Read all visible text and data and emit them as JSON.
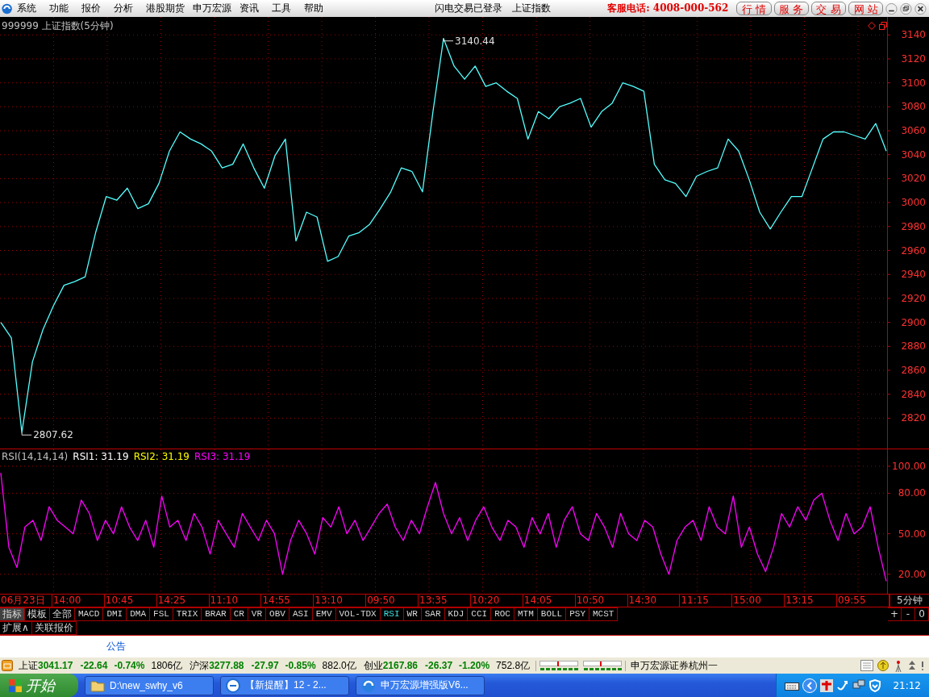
{
  "menu_bar": {
    "items": [
      "系统",
      "功能",
      "报价",
      "分析",
      "港股期货",
      "申万宏源",
      "资讯",
      "工具",
      "帮助"
    ],
    "login_status": "闪电交易已登录",
    "symbol": "上证指数",
    "hotline": "客服电话: 4008-000-562",
    "service_buttons": [
      "行 情",
      "服 务",
      "交 易",
      "网 站"
    ]
  },
  "price_panel": {
    "title": "999999 上证指数(5分钟)",
    "chart_data": {
      "type": "line",
      "ylim": [
        2794,
        3155
      ],
      "grid": true,
      "yticks": [
        2820,
        2840,
        2860,
        2880,
        2900,
        2920,
        2940,
        2960,
        2980,
        3000,
        3020,
        3040,
        3060,
        3080,
        3100,
        3120,
        3140
      ],
      "categories": [
        null,
        null,
        null,
        null,
        null,
        null,
        null,
        null,
        null,
        null,
        null,
        null,
        null,
        null,
        null,
        null,
        null,
        null,
        null,
        null,
        null,
        null,
        null,
        null,
        null,
        null,
        null,
        null,
        null,
        null,
        null,
        null,
        null,
        null,
        null,
        null,
        null,
        null,
        null,
        null,
        null,
        null,
        null,
        null,
        null,
        null,
        null,
        null,
        null,
        null,
        null,
        null,
        null,
        null,
        null,
        null,
        null,
        null,
        null,
        null,
        null,
        null,
        null,
        null,
        null,
        null,
        null,
        null,
        null,
        null,
        null,
        null,
        null,
        null,
        null,
        null,
        null,
        null,
        null,
        null,
        null,
        null,
        null,
        null,
        null
      ],
      "series": [
        {
          "color": "#54ffff",
          "values": [
            2900,
            2887,
            2808,
            2867,
            2894,
            2914,
            2931,
            2934,
            2938,
            2975,
            3005,
            3002,
            3012,
            2995,
            2999,
            3016,
            3043,
            3059,
            3053,
            3049,
            3043,
            3029,
            3032,
            3049,
            3029,
            3012,
            3039,
            3053,
            2968,
            2992,
            2988,
            2951,
            2955,
            2972,
            2975,
            2982,
            2995,
            3009,
            3029,
            3026,
            3009,
            3076,
            3137,
            3114,
            3103,
            3114,
            3097,
            3100,
            3093,
            3087,
            3053,
            3076,
            3070,
            3080,
            3083,
            3087,
            3063,
            3076,
            3083,
            3100,
            3097,
            3093,
            3032,
            3019,
            3016,
            3005,
            3022,
            3026,
            3029,
            3053,
            3043,
            3019,
            2992,
            2978,
            2992,
            3005,
            3005,
            3029,
            3053,
            3059,
            3059,
            3056,
            3053,
            3066,
            3043
          ]
        }
      ]
    },
    "extreme_labels": [
      {
        "kind": "max",
        "text": "3140.44"
      },
      {
        "kind": "min",
        "text": "2807.62"
      }
    ]
  },
  "rsi_panel": {
    "legend": [
      {
        "text": "RSI(14,14,14)",
        "color": "#c0c0c0"
      },
      {
        "text": "RSI1: 31.19",
        "color": "#ffffff"
      },
      {
        "text": "RSI2: 31.19",
        "color": "#ffff00"
      },
      {
        "text": "RSI3: 31.19",
        "color": "#ff00ff"
      }
    ],
    "chart_data": {
      "type": "line",
      "ylim": [
        5,
        112.5
      ],
      "grid": true,
      "yticks": [
        {
          "value": 20,
          "label": "20.00"
        },
        {
          "value": 50,
          "label": "50.00"
        },
        {
          "value": 80,
          "label": "80.00"
        },
        {
          "value": 100,
          "label": "100.00"
        }
      ],
      "categories": [
        null,
        null,
        null,
        null,
        null,
        null,
        null,
        null,
        null,
        null,
        null,
        null,
        null,
        null,
        null,
        null,
        null,
        null,
        null,
        null,
        null,
        null,
        null,
        null,
        null,
        null,
        null,
        null,
        null,
        null,
        null,
        null,
        null,
        null,
        null,
        null,
        null,
        null,
        null,
        null,
        null,
        null,
        null,
        null,
        null,
        null,
        null,
        null,
        null,
        null,
        null,
        null,
        null,
        null,
        null,
        null,
        null,
        null,
        null,
        null,
        null,
        null,
        null,
        null,
        null,
        null,
        null,
        null,
        null,
        null,
        null,
        null,
        null,
        null,
        null,
        null,
        null,
        null,
        null,
        null,
        null,
        null,
        null,
        null,
        null,
        null,
        null,
        null,
        null,
        null,
        null,
        null,
        null,
        null,
        null,
        null,
        null,
        null,
        null,
        null,
        null,
        null,
        null,
        null,
        null,
        null,
        null,
        null,
        null,
        null,
        null
      ],
      "series": [
        {
          "color": "#ff00ff",
          "values": [
            95,
            40,
            25,
            55,
            60,
            45,
            70,
            60,
            55,
            50,
            75,
            65,
            45,
            60,
            50,
            70,
            55,
            45,
            60,
            40,
            78,
            55,
            60,
            45,
            65,
            55,
            35,
            60,
            50,
            40,
            65,
            55,
            45,
            60,
            50,
            20,
            45,
            60,
            50,
            35,
            62,
            55,
            70,
            50,
            60,
            45,
            55,
            65,
            72,
            55,
            45,
            60,
            50,
            70,
            88,
            65,
            50,
            62,
            45,
            60,
            70,
            55,
            45,
            60,
            55,
            40,
            62,
            50,
            65,
            40,
            60,
            70,
            50,
            45,
            65,
            55,
            40,
            65,
            50,
            45,
            60,
            55,
            35,
            20,
            45,
            55,
            60,
            45,
            70,
            55,
            50,
            78,
            40,
            55,
            35,
            22,
            40,
            65,
            55,
            70,
            60,
            75,
            80,
            60,
            45,
            65,
            50,
            55,
            70,
            40,
            15
          ]
        }
      ]
    }
  },
  "time_axis": {
    "labels": [
      "06月23日",
      "14:00",
      "10:45",
      "14:25",
      "11:10",
      "14:55",
      "13:10",
      "09:50",
      "13:35",
      "10:20",
      "14:05",
      "10:50",
      "14:30",
      "11:15",
      "15:00",
      "13:15",
      "09:55"
    ],
    "period": "5分钟"
  },
  "panel_tabs": [
    {
      "label": "指标",
      "selected": true
    },
    {
      "label": "模板",
      "selected": false
    },
    {
      "label": "全部",
      "selected": false
    }
  ],
  "indicator_tabs": [
    {
      "label": "MACD",
      "selected": false
    },
    {
      "label": "DMI",
      "selected": false
    },
    {
      "label": "DMA",
      "selected": false
    },
    {
      "label": "FSL",
      "selected": false
    },
    {
      "label": "TRIX",
      "selected": false
    },
    {
      "label": "BRAR",
      "selected": false
    },
    {
      "label": "CR",
      "selected": false
    },
    {
      "label": "VR",
      "selected": false
    },
    {
      "label": "OBV",
      "selected": false
    },
    {
      "label": "ASI",
      "selected": false
    },
    {
      "label": "EMV",
      "selected": false
    },
    {
      "label": "VOL-TDX",
      "selected": false
    },
    {
      "label": "RSI",
      "selected": true
    },
    {
      "label": "WR",
      "selected": false
    },
    {
      "label": "SAR",
      "selected": false
    },
    {
      "label": "KDJ",
      "selected": false
    },
    {
      "label": "CCI",
      "selected": false
    },
    {
      "label": "ROC",
      "selected": false
    },
    {
      "label": "MTM",
      "selected": false
    },
    {
      "label": "BOLL",
      "selected": false
    },
    {
      "label": "PSY",
      "selected": false
    },
    {
      "label": "MCST",
      "selected": false
    }
  ],
  "zoom_buttons": [
    "+",
    "-",
    "0"
  ],
  "sub_tabs": [
    "扩展∧",
    "关联报价"
  ],
  "notice": "公告",
  "status_bar": {
    "indices": [
      {
        "name": "上证",
        "value": "3041.17",
        "change": "-22.64",
        "percent": "-0.74%",
        "turnover": "1806亿"
      },
      {
        "name": "沪深",
        "value": "3277.88",
        "change": "-27.97",
        "percent": "-0.85%",
        "turnover": "882.0亿"
      },
      {
        "name": "创业",
        "value": "2167.86",
        "change": "-26.37",
        "percent": "-1.20%",
        "turnover": "752.8亿"
      }
    ],
    "broker": "申万宏源证券杭州一"
  },
  "taskbar": {
    "start": "开始",
    "tasks": [
      {
        "kind": "folder",
        "label": "D:\\new_swhy_v6"
      },
      {
        "kind": "browser",
        "label": "【新提醒】12 - 2..."
      },
      {
        "kind": "app",
        "label": "申万宏源增强版V6..."
      }
    ],
    "clock": "21:12"
  }
}
